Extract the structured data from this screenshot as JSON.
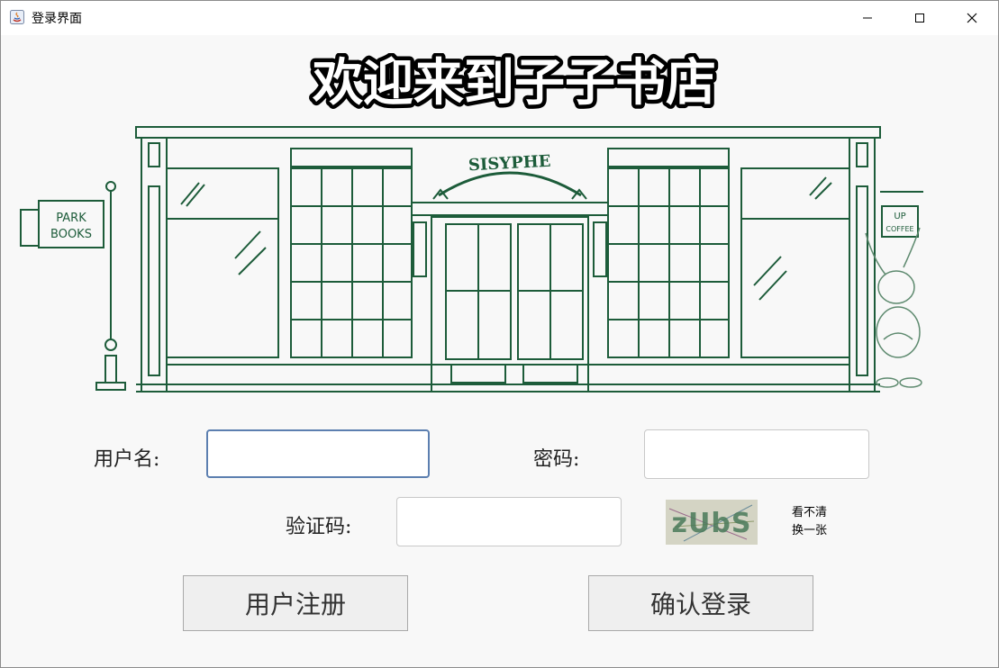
{
  "window": {
    "title": "登录界面",
    "controls": [
      "minimize",
      "maximize",
      "close"
    ]
  },
  "header": {
    "headline": "欢迎来到子子书店"
  },
  "storefront": {
    "shop_sign": "SISYPHE",
    "flag_line1": "PARK",
    "flag_line2": "BOOKS",
    "cafe_sign_line1": "UP",
    "cafe_sign_line2": "COFFEE"
  },
  "form": {
    "username_label": "用户名:",
    "username_value": "",
    "password_label": "密码:",
    "password_value": "",
    "captcha_label": "验证码:",
    "captcha_value": "",
    "captcha_text": "zUbS",
    "refresh_line1": "看不清",
    "refresh_line2": "换一张"
  },
  "buttons": {
    "register": "用户注册",
    "login": "确认登录"
  },
  "colors": {
    "ink": "#1d5c3a",
    "focus_border": "#5c7fb0",
    "button_bg": "#efefef"
  }
}
